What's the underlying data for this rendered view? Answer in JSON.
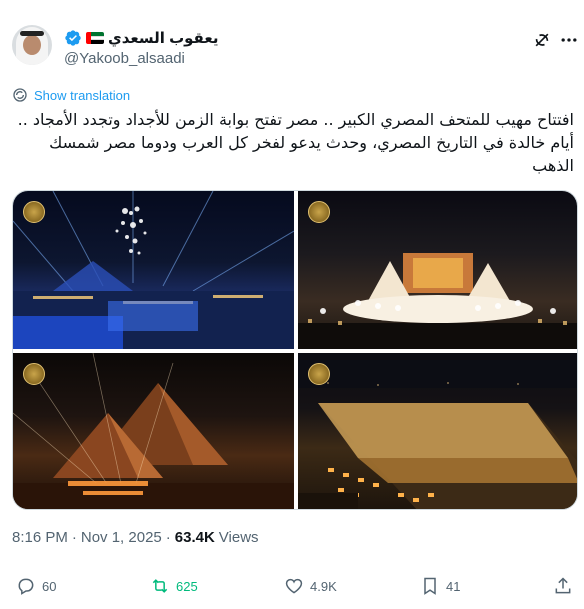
{
  "author": {
    "display_name": "يعقوب السعدي",
    "handle": "@Yakoob_alsaadi",
    "verified": true,
    "flag": "uae-flag"
  },
  "header_icons": [
    "grok-icon",
    "more-icon"
  ],
  "translate": {
    "label": "Show translation"
  },
  "tweet": {
    "lines": [
      "افتتاح مهيب للمتحف  المصري الكبير .. مصر تفتح بوابة الزمن للأجداد وتجدد الأمجاد ..",
      "أيام خالدة في التاريخ المصري، وحدث يدعو لفخر كل العرب ودوما مصر شمسك",
      "الذهب"
    ]
  },
  "media": {
    "photos": [
      {
        "name": "photo-drone-show"
      },
      {
        "name": "photo-stage-performance"
      },
      {
        "name": "photo-pyramids-illuminated"
      },
      {
        "name": "photo-museum-aerial"
      }
    ]
  },
  "meta": {
    "time": "8:16 PM",
    "separator": "·",
    "date": "Nov 1, 2025",
    "views_count": "63.4K",
    "views_label": "Views"
  },
  "actions": {
    "replies": "60",
    "reposts": "625",
    "likes": "4.9K",
    "bookmarks": "41"
  },
  "colors": {
    "accent": "#1d9bf0",
    "repost_active": "#00ba7c",
    "secondary_text": "#536471",
    "primary_text": "#0f1419"
  }
}
